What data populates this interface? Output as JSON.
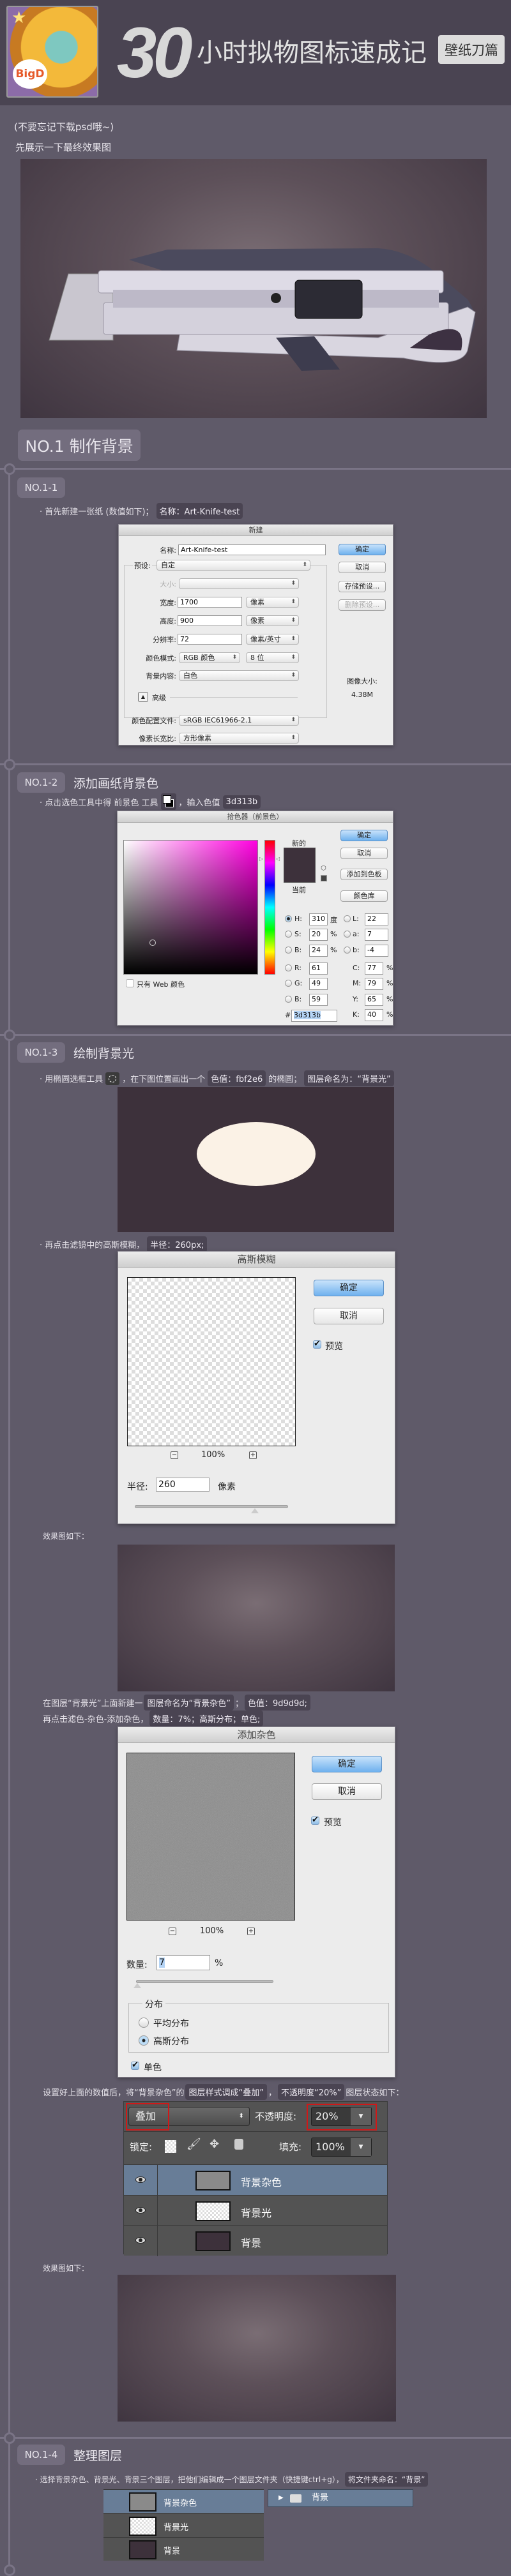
{
  "header": {
    "logo_text": "BigD",
    "title_number": "30",
    "title": "小时拟物图标速成记",
    "badge": "壁纸刀篇"
  },
  "intro": {
    "note": "(不要忘记下载psd哦~)",
    "preview_label": "先展示一下最终效果图"
  },
  "section": {
    "label": "NO.1 制作背景"
  },
  "step1": {
    "label": "NO.1-1",
    "text": "· 首先新建一张纸 (数值如下)；",
    "highlight": "名称：Art-Knife-test",
    "dialog": {
      "title": "新建",
      "name_label": "名称:",
      "name_value": "Art-Knife-test",
      "preset_label": "预设:",
      "preset_value": "自定",
      "size_label": "大小:",
      "width_label": "宽度:",
      "width_value": "1700",
      "width_unit": "像素",
      "height_label": "高度:",
      "height_value": "900",
      "height_unit": "像素",
      "res_label": "分辨率:",
      "res_value": "72",
      "res_unit": "像素/英寸",
      "mode_label": "颜色模式:",
      "mode_value": "RGB 颜色",
      "bits_value": "8 位",
      "bg_label": "背景内容:",
      "bg_value": "白色",
      "advanced_label": "高级",
      "profile_label": "颜色配置文件:",
      "profile_value": "sRGB IEC61966-2.1",
      "aspect_label": "像素长宽比:",
      "aspect_value": "方形像素",
      "ok": "确定",
      "cancel": "取消",
      "save_preset": "存储预设...",
      "delete_preset": "删除预设...",
      "image_size_label": "图像大小:",
      "image_size_value": "4.38M"
    }
  },
  "step2": {
    "label": "NO.1-2",
    "title": "添加画纸背景色",
    "text_a": "· 点击选色工具中得 前景色 工具",
    "text_b": "，输入色值",
    "highlight": "3d313b",
    "dialog": {
      "title": "拾色器（前景色）",
      "new_label": "新的",
      "current_label": "当前",
      "ok": "确定",
      "cancel": "取消",
      "add_swatch": "添加到色板",
      "color_lib": "颜色库",
      "web_only": "只有 Web 颜色",
      "fields": [
        {
          "label": "H:",
          "value": "310",
          "unit": "度",
          "checked": true
        },
        {
          "label": "S:",
          "value": "20",
          "unit": "%"
        },
        {
          "label": "B:",
          "value": "24",
          "unit": "%"
        },
        {
          "label": "R:",
          "value": "61",
          "unit": ""
        },
        {
          "label": "G:",
          "value": "49",
          "unit": ""
        },
        {
          "label": "B:",
          "value": "59",
          "unit": ""
        }
      ],
      "lab": [
        {
          "label": "L:",
          "value": "22"
        },
        {
          "label": "a:",
          "value": "7"
        },
        {
          "label": "b:",
          "value": "-4"
        }
      ],
      "cmyk": [
        {
          "label": "C:",
          "value": "77",
          "unit": "%"
        },
        {
          "label": "M:",
          "value": "79",
          "unit": "%"
        },
        {
          "label": "Y:",
          "value": "65",
          "unit": "%"
        },
        {
          "label": "K:",
          "value": "40",
          "unit": "%"
        }
      ],
      "hex_label": "#",
      "hex_value": "3d313b",
      "color": "#3d313b"
    }
  },
  "step3": {
    "label": "NO.1-3",
    "title": "绘制背景光",
    "text_a": "· 用椭圆选框工具",
    "text_b": "，在下图位置画出一个",
    "hl_color": "色值：fbf2e6",
    "text_c": "的椭圆；",
    "hl_name": "图层命名为：“背景光”",
    "ellipse_color": "#fbf2e6",
    "blur_text": "· 再点击滤镜中的高斯模糊，",
    "blur_hl": "半径：260px;",
    "blur_dialog": {
      "title": "高斯模糊",
      "ok": "确定",
      "cancel": "取消",
      "preview": "预览",
      "zoom": "100%",
      "radius_label": "半径:",
      "radius_value": "260",
      "radius_unit": "像素"
    },
    "effect_label": "效果图如下：",
    "noise_text_a": "在图层“背景光”上面新建一",
    "noise_hl_a": "图层命名为“背景杂色”",
    "noise_sep": "；",
    "noise_hl_b": "色值：9d9d9d;",
    "noise_text_b": "再点击滤色-杂色-添加杂色，",
    "noise_hl_c": "数量：7%；高斯分布；单色;",
    "noise_dialog": {
      "title": "添加杂色",
      "ok": "确定",
      "cancel": "取消",
      "preview": "预览",
      "zoom": "100%",
      "amount_label": "数量:",
      "amount_value": "7",
      "amount_unit": "%",
      "dist_label": "分布",
      "uniform": "平均分布",
      "gaussian": "高斯分布",
      "mono": "单色"
    },
    "style_text_a": "设置好上面的数值后，将“背景杂色”的",
    "style_hl_a": "图层样式调成“叠加”",
    "style_sep": "，",
    "style_hl_b": "不透明度“20%”",
    "style_text_b": "图层状态如下：",
    "layers_panel": {
      "blend": "叠加",
      "opacity_label": "不透明度:",
      "opacity": "20%",
      "lock_label": "锁定:",
      "fill_label": "填充:",
      "fill": "100%",
      "layers": [
        {
          "name": "背景杂色",
          "selected": true
        },
        {
          "name": "背景光"
        },
        {
          "name": "背景"
        }
      ]
    },
    "effect_label_2": "效果图如下："
  },
  "step4": {
    "label": "NO.1-4",
    "title": "整理图层",
    "text": "· 选择背景杂色、背景光、背景三个图层，把他们编辑成一个图层文件夹（快捷键ctrl+g），",
    "highlight": "将文件夹命名：“背景”",
    "layers": [
      "背景杂色",
      "背景光",
      "背景"
    ],
    "folder": "背景"
  }
}
